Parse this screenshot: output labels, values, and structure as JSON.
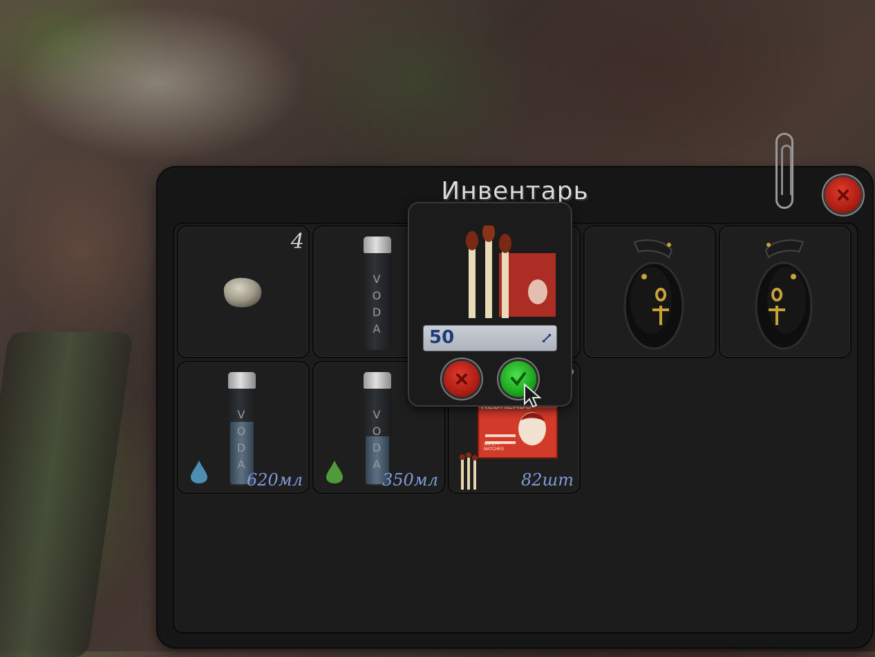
{
  "window": {
    "title": "Инвентарь"
  },
  "slots": [
    {
      "name": "stone",
      "count": "4"
    },
    {
      "name": "voda-bottle",
      "brand": "VODA"
    },
    {
      "name": "matches-hidden"
    },
    {
      "name": "sandal-left"
    },
    {
      "name": "sandal-right"
    },
    {
      "name": "voda-bottle-blue",
      "brand": "VODA",
      "amount": "620мл",
      "fill": 0.55
    },
    {
      "name": "voda-bottle-green",
      "brand": "VODA",
      "amount": "350мл",
      "fill": 0.42
    },
    {
      "name": "matchbox",
      "count": "2",
      "amount": "82шт",
      "box_brand": "REDHEADS",
      "box_subtitle": "SAFETY MATCHES"
    }
  ],
  "split_popup": {
    "quantity": "50",
    "item": "matches"
  },
  "colors": {
    "panel": "#161616",
    "amount_text": "#7f9bd8",
    "cancel": "#c42a1c",
    "confirm": "#22b022",
    "drop_blue": "#4d8fb4",
    "drop_green": "#4f9a3a"
  }
}
